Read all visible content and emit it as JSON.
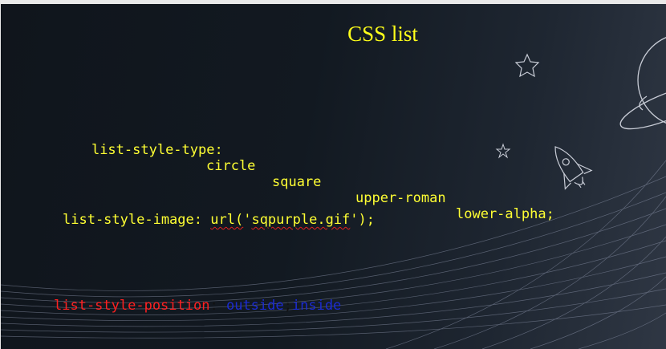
{
  "slide": {
    "title": "CSS list",
    "line1": {
      "property": "list-style-type:",
      "values": [
        "circle",
        "square",
        "upper-roman",
        "lower-alpha;"
      ]
    },
    "line2": {
      "property": "list-style-image:",
      "func_open": "url(",
      "q1": "'",
      "filename": "sqpurple.gif",
      "q2": "'",
      "func_close": ");"
    },
    "line3": {
      "property": "list-style-position",
      "colon": ":",
      "value1": "outside",
      "separator": ";",
      "value2": "inside"
    },
    "decorations": [
      "star-icon",
      "planet-icon",
      "rocket-icon",
      "mesh-wave"
    ]
  },
  "colors": {
    "title": "#ffff1a",
    "code": "#ffff33",
    "property_red": "#ff2020",
    "value_blue": "#1b2bd2"
  }
}
